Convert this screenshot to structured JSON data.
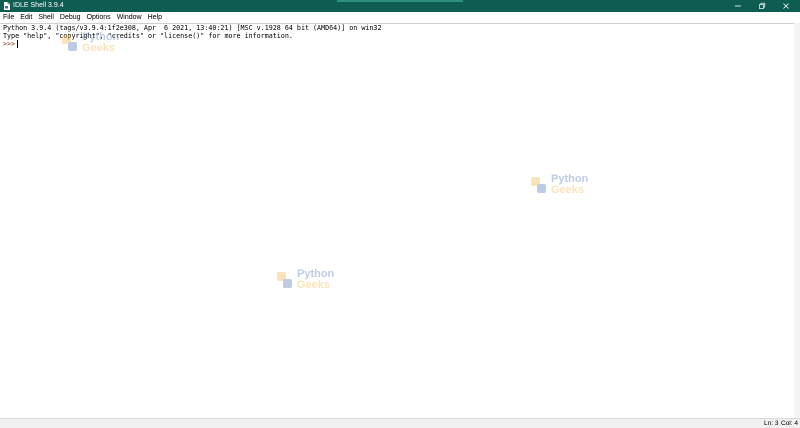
{
  "window": {
    "title": "IDLE Shell 3.9.4",
    "icon": "idle-file-icon",
    "controls": [
      "minimize-icon",
      "maximize-icon",
      "close-icon"
    ]
  },
  "menubar": {
    "items": [
      {
        "label": "File"
      },
      {
        "label": "Edit"
      },
      {
        "label": "Shell"
      },
      {
        "label": "Debug"
      },
      {
        "label": "Options"
      },
      {
        "label": "Window"
      },
      {
        "label": "Help"
      }
    ]
  },
  "shell": {
    "lines": [
      "Python 3.9.4 (tags/v3.9.4:1f2e308, Apr  6 2021, 13:40:21) [MSC v.1928 64 bit (AMD64)] on win32",
      "Type \"help\", \"copyright\", \"credits\" or \"license()\" for more information."
    ],
    "prompt": ">>>"
  },
  "watermark": {
    "word1": "Python",
    "word2": "Geeks",
    "logo": "python-logo-icon"
  },
  "statusbar": {
    "line": "Ln: 3",
    "column": "Col: 4"
  },
  "colors": {
    "titlebar": "#0f5c52",
    "prompt": "#7b1a00",
    "watermark_blue": "#6f8fc4",
    "watermark_yellow": "#f2c26a"
  }
}
